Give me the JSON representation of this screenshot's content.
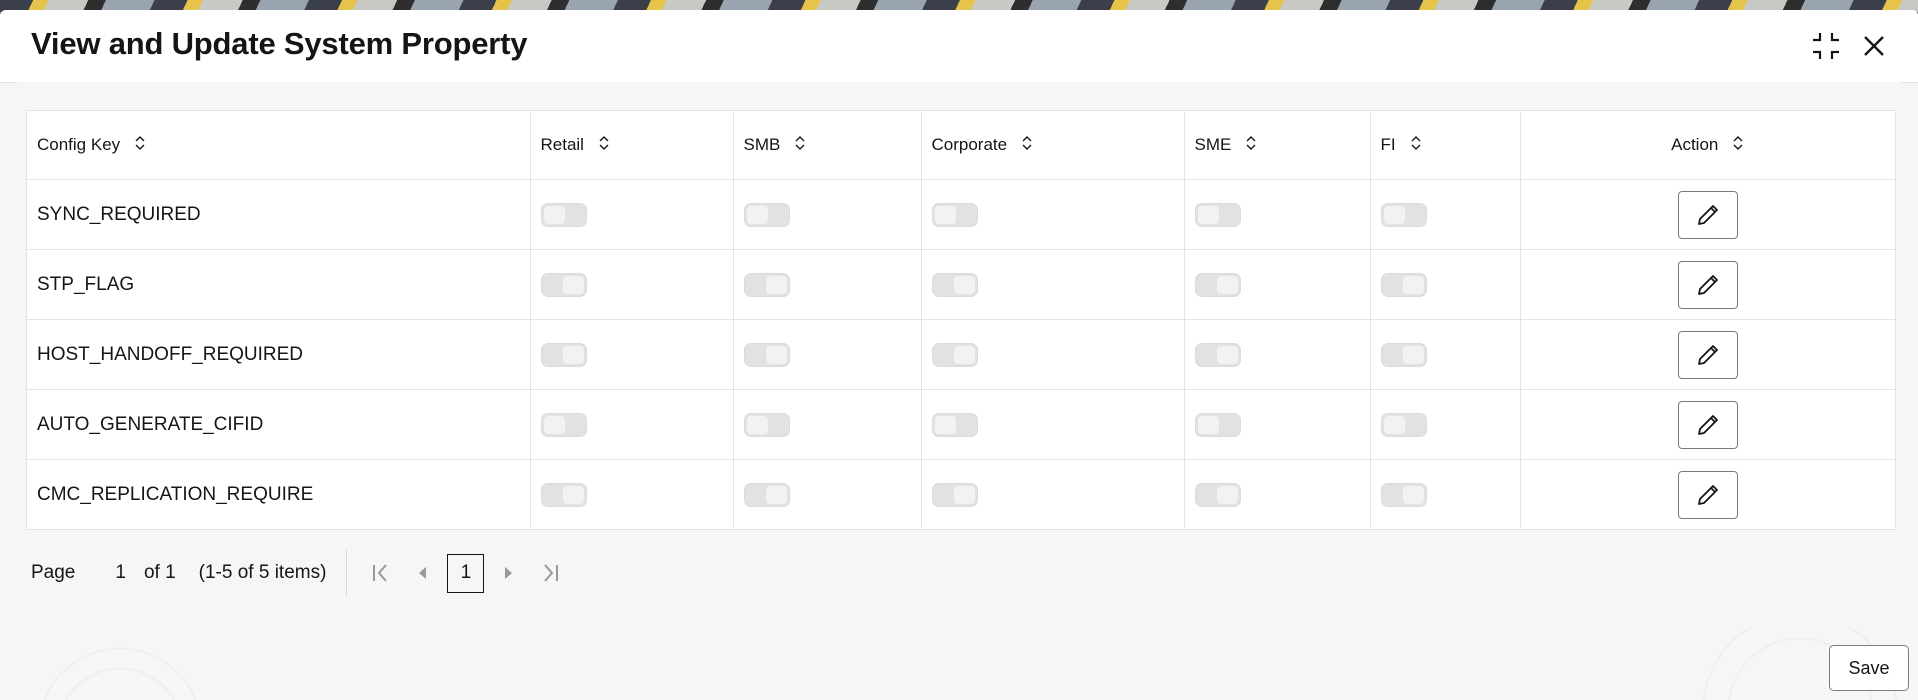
{
  "dialog": {
    "title": "View and Update System Property",
    "minimize_icon": "collapse-corners-icon",
    "close_icon": "close-icon"
  },
  "table": {
    "columns": [
      {
        "label": "Config Key",
        "sortable": true
      },
      {
        "label": "Retail",
        "sortable": true
      },
      {
        "label": "SMB",
        "sortable": true
      },
      {
        "label": "Corporate",
        "sortable": true
      },
      {
        "label": "SME",
        "sortable": true
      },
      {
        "label": "FI",
        "sortable": true
      },
      {
        "label": "Action",
        "sortable": true
      }
    ],
    "rows": [
      {
        "key": "SYNC_REQUIRED",
        "retail": false,
        "smb": false,
        "corporate": false,
        "sme": false,
        "fi": false,
        "action_icon": "pencil-icon"
      },
      {
        "key": "STP_FLAG",
        "retail": true,
        "smb": true,
        "corporate": true,
        "sme": true,
        "fi": true,
        "action_icon": "pencil-icon"
      },
      {
        "key": "HOST_HANDOFF_REQUIRED",
        "retail": true,
        "smb": true,
        "corporate": true,
        "sme": true,
        "fi": true,
        "action_icon": "pencil-icon"
      },
      {
        "key": "AUTO_GENERATE_CIFID",
        "retail": false,
        "smb": false,
        "corporate": false,
        "sme": false,
        "fi": false,
        "action_icon": "pencil-icon"
      },
      {
        "key": "CMC_REPLICATION_REQUIRE",
        "retail": true,
        "smb": true,
        "corporate": true,
        "sme": true,
        "fi": true,
        "action_icon": "pencil-icon"
      }
    ]
  },
  "pagination": {
    "page_label": "Page",
    "current_page": "1",
    "of_label": "of 1",
    "items_label": "(1-5 of 5 items)",
    "page_button": "1"
  },
  "footer": {
    "save_label": "Save"
  }
}
